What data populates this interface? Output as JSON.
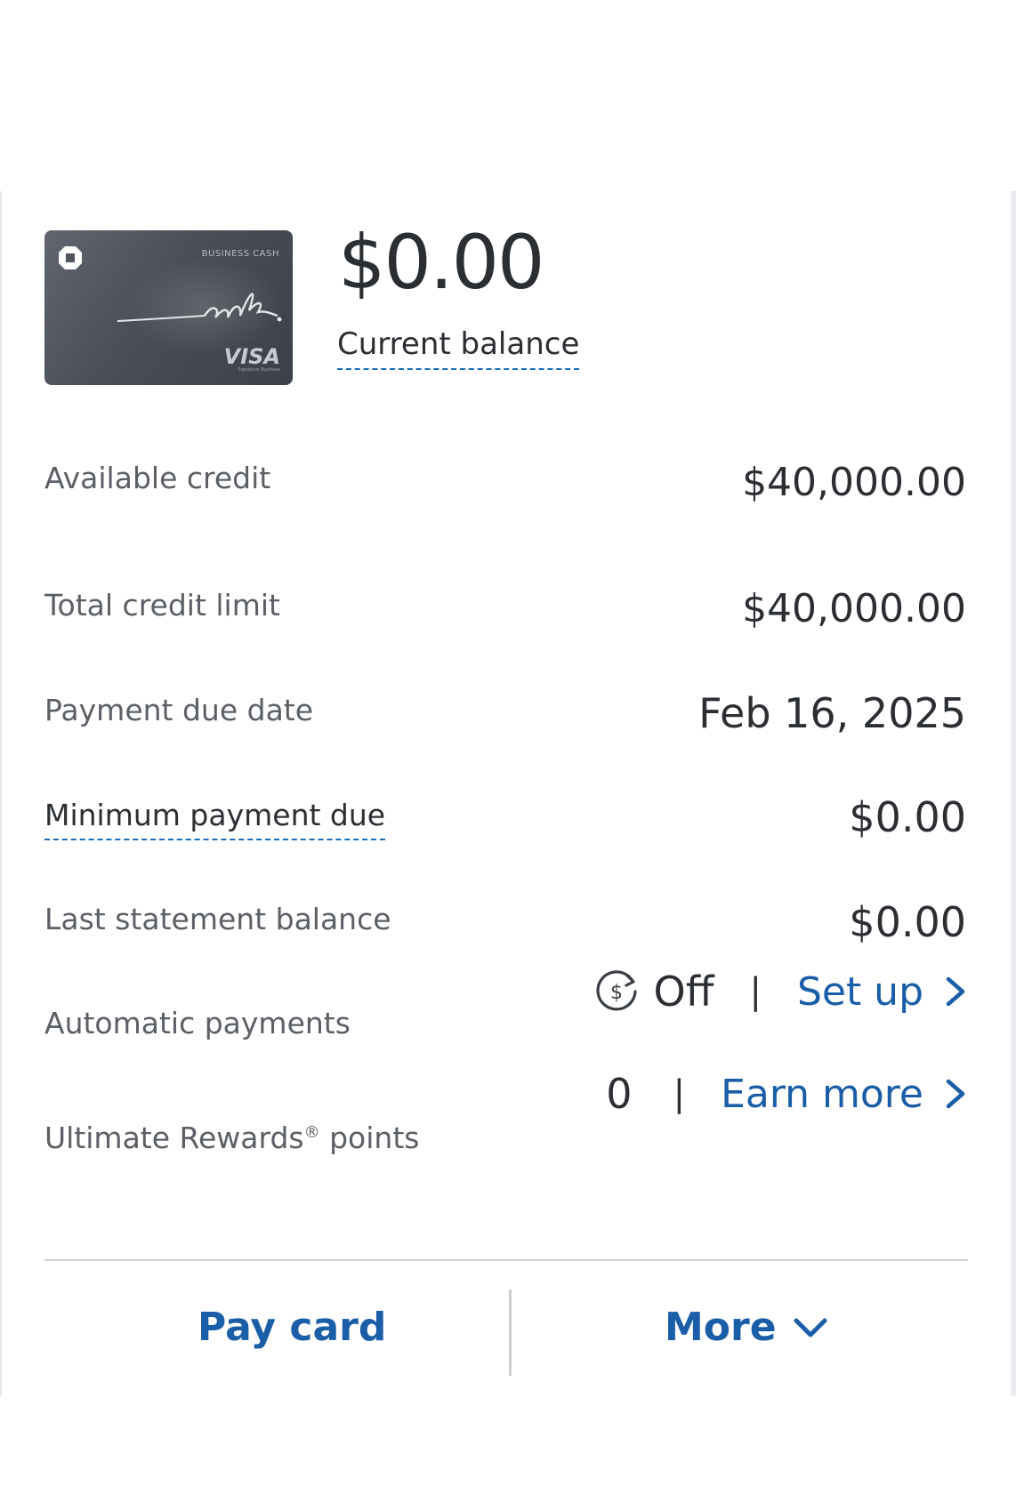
{
  "card": {
    "brand_text": "BUSINESS CASH",
    "network": "VISA",
    "sub_text": "Signature Business"
  },
  "balance": {
    "amount": "$0.00",
    "label": "Current balance"
  },
  "rows": {
    "available_credit": {
      "label": "Available credit",
      "value": "$40,000.00"
    },
    "total_credit_limit": {
      "label": "Total credit limit",
      "value": "$40,000.00"
    },
    "payment_due_date": {
      "label": "Payment due date",
      "value": "Feb 16, 2025"
    },
    "minimum_payment_due": {
      "label": "Minimum payment due",
      "value": "$0.00"
    },
    "last_statement_balance": {
      "label": "Last statement balance",
      "value": "$0.00"
    }
  },
  "autopay": {
    "label": "Automatic payments",
    "status": "Off",
    "separator": "|",
    "link": "Set up"
  },
  "rewards": {
    "label_main": "Ultimate Rewards",
    "label_mark": "®",
    "label_suffix": " points",
    "value": "0",
    "separator": "|",
    "link": "Earn more"
  },
  "actions": {
    "pay_card": "Pay card",
    "more": "More"
  },
  "colors": {
    "link_blue": "#1a5ea8",
    "text_dark": "#2b2f33",
    "text_label": "#5b6066",
    "dotted_underline": "#1a6fb8"
  },
  "icons": {
    "card_logo": "chase-octagon-icon",
    "autopay": "autopay-dollar-refresh-icon",
    "chevron_right": "chevron-right-icon",
    "chevron_down": "chevron-down-icon"
  }
}
